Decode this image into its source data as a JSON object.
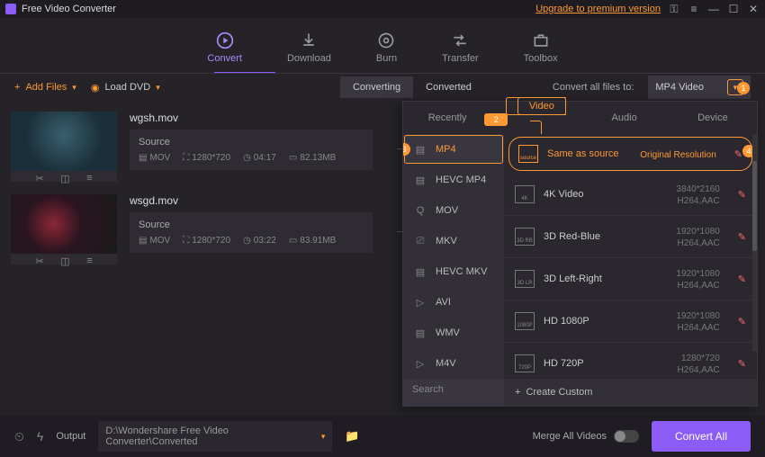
{
  "titlebar": {
    "app_title": "Free Video Converter",
    "premium": "Upgrade to premium version"
  },
  "main_tabs": {
    "convert": "Convert",
    "download": "Download",
    "burn": "Burn",
    "transfer": "Transfer",
    "toolbox": "Toolbox"
  },
  "toolbar": {
    "add_files": "Add Files",
    "load_dvd": "Load DVD",
    "converting": "Converting",
    "converted": "Converted",
    "convert_all_to": "Convert all files to:",
    "format_selected": "MP4 Video",
    "badge1": "1"
  },
  "files": [
    {
      "name": "wgsh.mov",
      "source": "Source",
      "fmt": "MOV",
      "res": "1280*720",
      "dur": "04:17",
      "size": "82.13MB"
    },
    {
      "name": "wsgd.mov",
      "source": "Source",
      "fmt": "MOV",
      "res": "1280*720",
      "dur": "03:22",
      "size": "83.91MB"
    }
  ],
  "panel": {
    "tabs": {
      "recently": "Recently",
      "video": "Video",
      "audio": "Audio",
      "device": "Device",
      "badge2": "2"
    },
    "formats": [
      "MP4",
      "HEVC MP4",
      "MOV",
      "MKV",
      "HEVC MKV",
      "AVI",
      "WMV",
      "M4V"
    ],
    "badge3": "3",
    "presets": [
      {
        "name": "Same as source",
        "sub": "Original Resolution",
        "icon": "source",
        "active": true
      },
      {
        "name": "4K Video",
        "sub": "3840*2160",
        "codec": "H264,AAC",
        "icon": "4K"
      },
      {
        "name": "3D Red-Blue",
        "sub": "1920*1080",
        "codec": "H264,AAC",
        "icon": "3D RB"
      },
      {
        "name": "3D Left-Right",
        "sub": "1920*1080",
        "codec": "H264,AAC",
        "icon": "3D LR"
      },
      {
        "name": "HD 1080P",
        "sub": "1920*1080",
        "codec": "H264,AAC",
        "icon": "1080P"
      },
      {
        "name": "HD 720P",
        "sub": "1280*720",
        "codec": "H264,AAC",
        "icon": "720P"
      }
    ],
    "badge4": "4",
    "search": "Search",
    "create_custom": "Create Custom"
  },
  "bottom": {
    "output": "Output",
    "path": "D:\\Wondershare Free Video Converter\\Converted",
    "merge": "Merge All Videos",
    "convert_all": "Convert All"
  }
}
